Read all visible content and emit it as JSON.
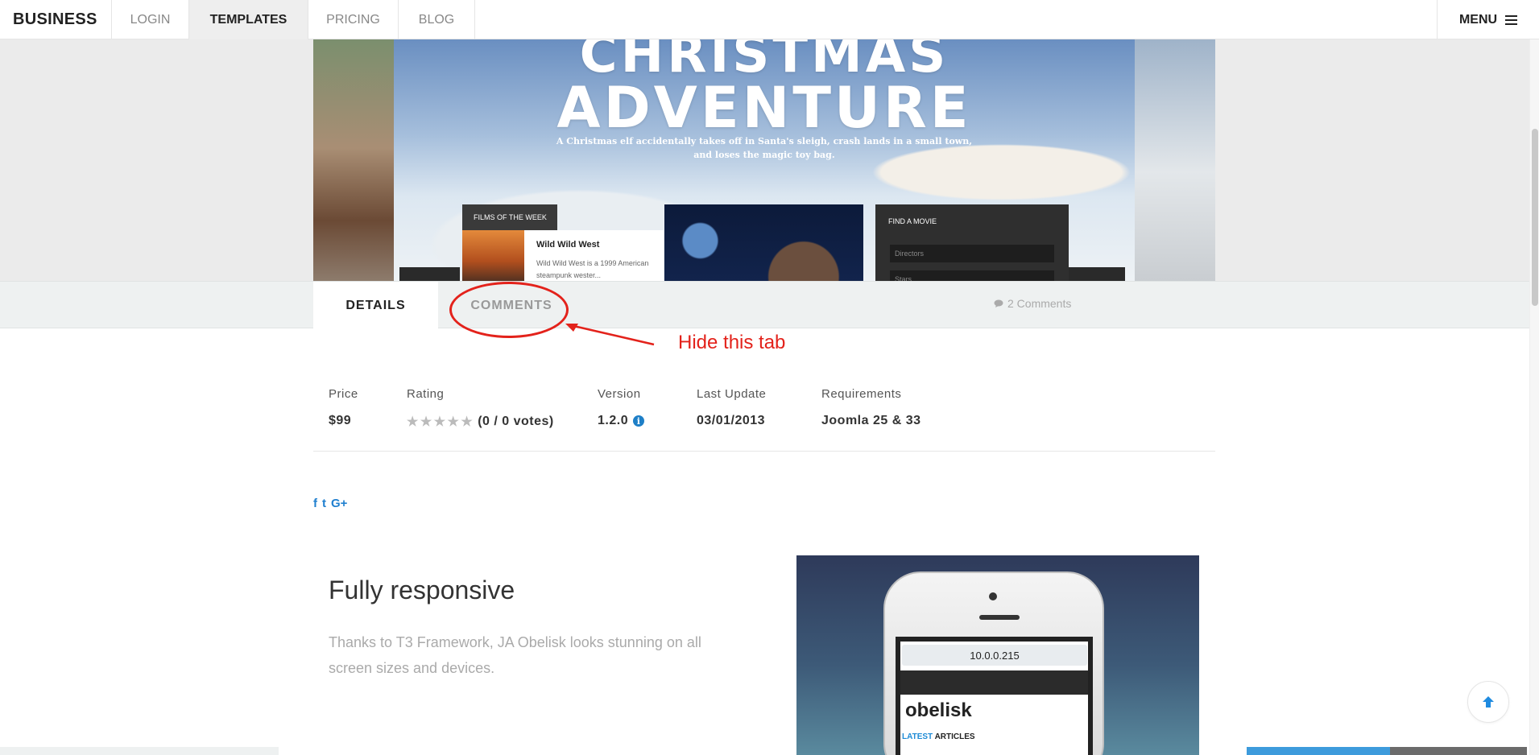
{
  "nav": {
    "brand": "BUSINESS",
    "items": [
      {
        "label": "LOGIN"
      },
      {
        "label": "TEMPLATES"
      },
      {
        "label": "PRICING"
      },
      {
        "label": "BLOG"
      }
    ],
    "menu_label": "MENU"
  },
  "hero": {
    "title_line1": "CHRISTMAS",
    "title_line2": "ADVENTURE",
    "subtitle": "A Christmas elf accidentally takes off in Santa's sleigh, crash lands in a small town, and loses the magic toy bag.",
    "films_heading": "FILMS OF THE WEEK",
    "film_title": "Wild Wild West",
    "film_desc": "Wild Wild West is a 1999 American steampunk wester...",
    "find_heading": "FIND A MOVIE",
    "find_field1": "Directors",
    "find_field2": "Stars"
  },
  "tabs": {
    "details": "DETAILS",
    "comments": "COMMENTS",
    "comments_count": "2 Comments"
  },
  "annotation": {
    "text": "Hide this tab",
    "color": "#e3221b"
  },
  "specs": {
    "price_label": "Price",
    "price_value": "$99",
    "rating_label": "Rating",
    "rating_value": "(0 / 0 votes)",
    "rating_stars": 0,
    "version_label": "Version",
    "version_value": "1.2.0",
    "update_label": "Last Update",
    "update_value": "03/01/2013",
    "req_label": "Requirements",
    "req_value": "Joomla 25 & 33"
  },
  "social": [
    "f",
    "t",
    "G+"
  ],
  "feature": {
    "title": "Fully responsive",
    "text": "Thanks to T3 Framework, JA Obelisk looks stunning on all screen sizes and devices.",
    "phone_url": "10.0.0.215",
    "phone_logo": "obelisk",
    "phone_section_accent": "LATEST",
    "phone_section_rest": " ARTICLES"
  },
  "colors": {
    "accent_blue": "#1f7fcf",
    "annotation_red": "#e3221b"
  }
}
